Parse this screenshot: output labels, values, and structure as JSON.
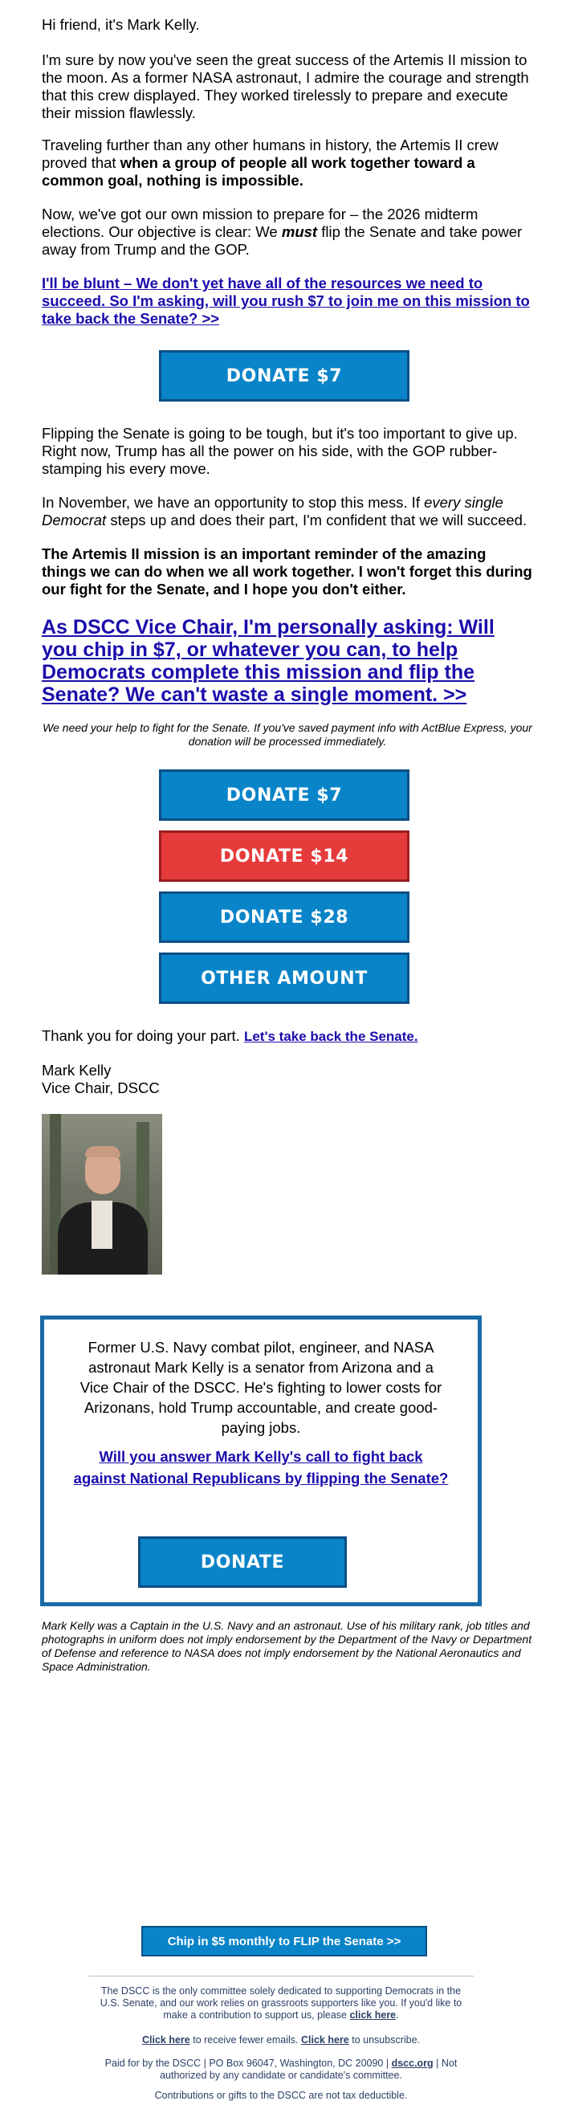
{
  "greeting": "Hi friend, it's Mark Kelly.",
  "para1": "I'm sure by now you've seen the great success of the Artemis II mission to the moon. As a former NASA astronaut, I admire the courage and strength that this crew displayed. They worked tirelessly to prepare and execute their mission flawlessly.",
  "para2": {
    "plain": "Traveling further than any other humans in history, the Artemis II crew proved that ",
    "bold": "when a group of people all work together toward a common goal, nothing is impossible."
  },
  "para3": {
    "before": "Now, we've got our own mission to prepare for – the 2026 midterm elections. Our objective is clear: We ",
    "emph": "must",
    "after": " flip the Senate and take power away from Trump and the GOP."
  },
  "link1": "I'll be blunt – We don't yet have all of the resources we need to succeed. So I'm asking, will you rush $7 to join me on this mission to take back the Senate? >>",
  "donate_btn_1": "DONATE $7",
  "para4": "Flipping the Senate is going to be tough, but it's too important to give up. Right now, Trump has all the power on his side, with the GOP rubber-stamping his every move.",
  "para5": {
    "before": "In November, we have an opportunity to stop this mess. If ",
    "emph": "every single Democrat",
    "after": " steps up and does their part, I'm confident that we will succeed."
  },
  "para6": "The Artemis II mission is an important reminder of the amazing things we can do when we all work together. I won't forget this during our fight for the Senate, and I hope you don't either.",
  "big_ask": "As DSCC Vice Chair, I'm personally asking: Will you chip in $7, or whatever you can, to help Democrats complete this mission and flip the Senate? We can't waste a single moment. >>",
  "actblue_note": "We need your help to fight for the Senate. If you've saved payment info with ActBlue Express, your donation will be processed immediately.",
  "donate_buttons": [
    "DONATE $7",
    "DONATE $14",
    "DONATE $28",
    "OTHER AMOUNT"
  ],
  "thanks": {
    "plain": "Thank you for doing your part. ",
    "link": "Let's take back the Senate."
  },
  "signature": {
    "name": "Mark Kelly",
    "title": "Vice Chair, DSCC"
  },
  "bio_box": {
    "bio": "Former U.S. Navy combat pilot, engineer, and NASA astronaut Mark Kelly is a senator from Arizona and a Vice Chair of the DSCC. He's fighting to lower costs for Arizonans, hold Trump accountable, and create good-paying jobs.",
    "link": "Will you answer Mark Kelly's call to fight back against National Republicans by flipping the Senate?",
    "button": "DONATE"
  },
  "disclaimer": "Mark Kelly was a Captain in the U.S. Navy and an astronaut. Use of his military rank, job titles and photographs in uniform does not imply endorsement by the Department of the Navy or Department of Defense and reference to NASA does not imply endorsement by the National Aeronautics and Space Administration.",
  "monthly_button": "Chip in $5 monthly to FLIP the Senate >>",
  "footer": {
    "about": "The DSCC is the only committee solely dedicated to supporting Democrats in the U.S. Senate, and our work relies on grassroots supporters like you. If you'd like to make a contribution to support us, please ",
    "about_link": "click here",
    "about_end": ".",
    "fewer_link": "Click here",
    "fewer_text": " to receive fewer emails. ",
    "unsub_link": "Click here",
    "unsub_text": " to unsubscribe.",
    "paid_for": "Paid for by the DSCC | PO Box 96047, Washington, DC 20090 | ",
    "site_link": "dscc.org",
    "paid_for_end": " | Not authorized by any candidate or candidate's committee.",
    "tax": "Contributions or gifts to the DSCC are not tax deductible."
  },
  "colors": {
    "button_blue": "#0a84c8",
    "button_red": "#e63b3b",
    "link_blue": "#1a0dab",
    "box_border": "#1a6aa8",
    "footer_text": "#2b3f66"
  }
}
